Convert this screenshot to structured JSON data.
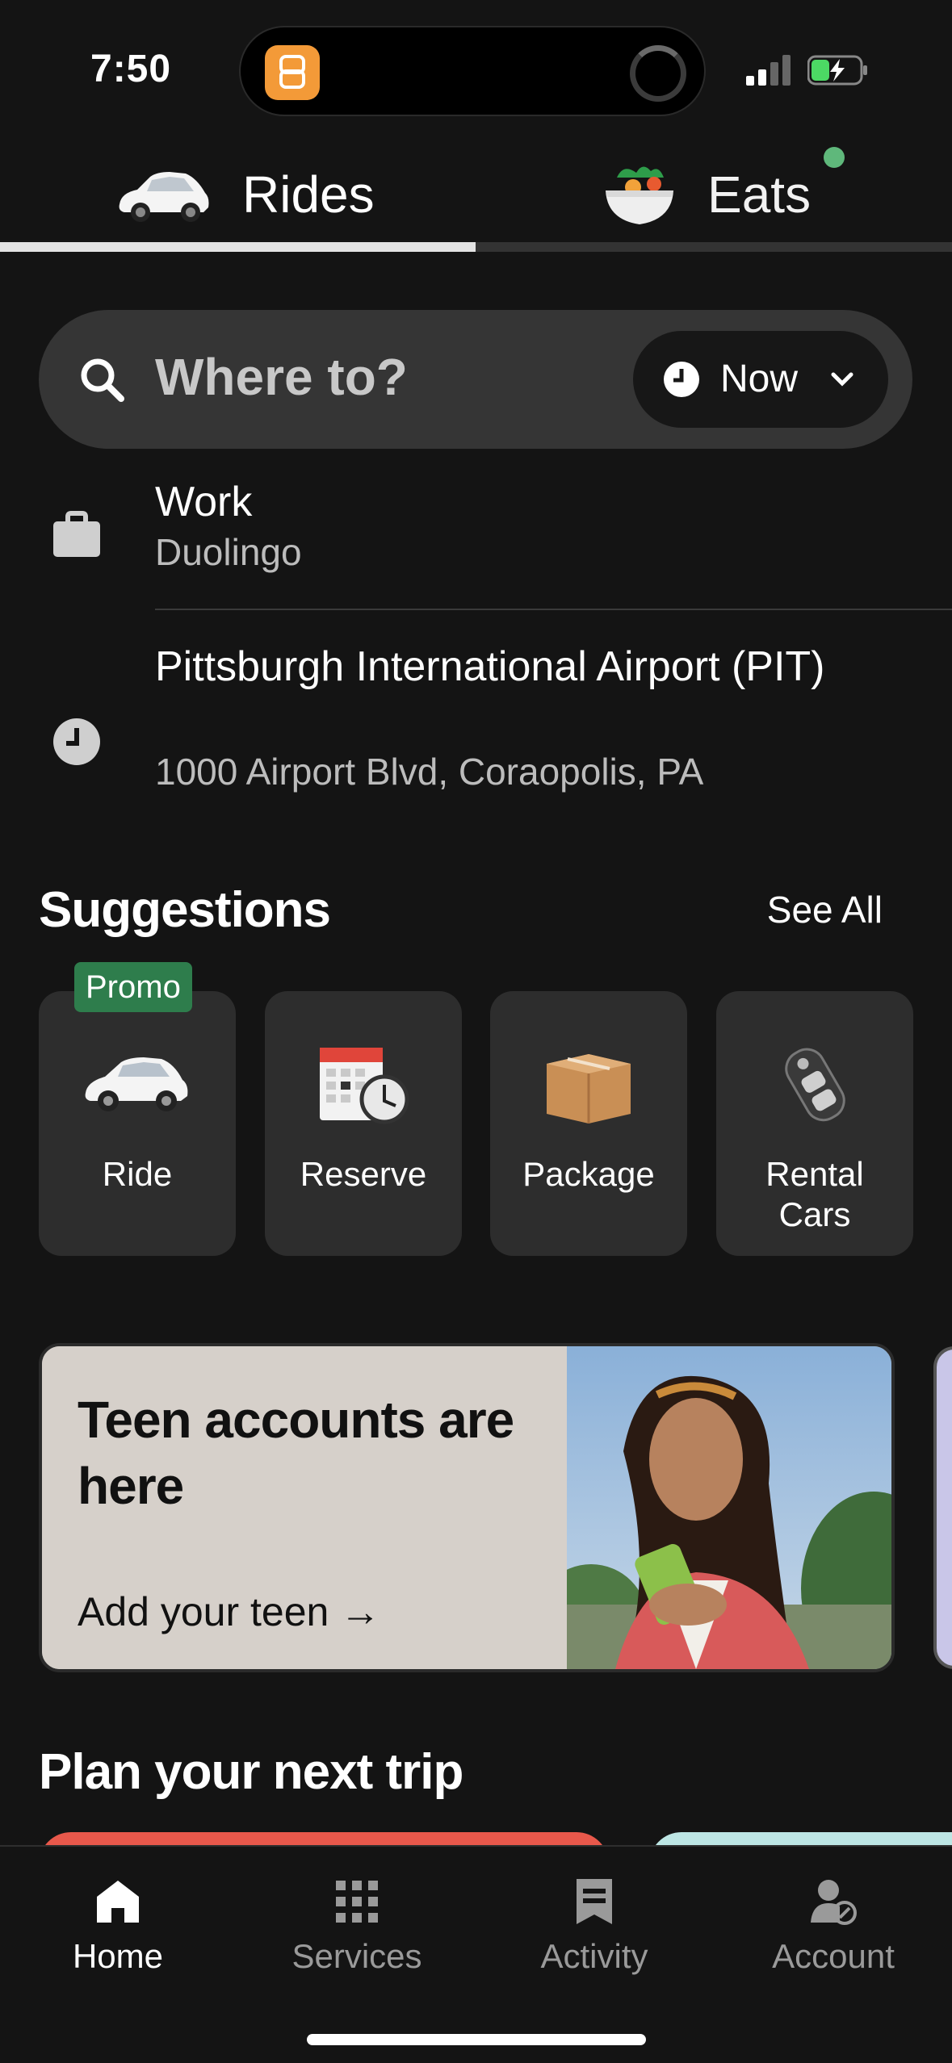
{
  "status_bar": {
    "time": "7:50"
  },
  "top_tabs": [
    {
      "label": "Rides",
      "icon": "car-icon",
      "active": true
    },
    {
      "label": "Eats",
      "icon": "food-bowl-icon",
      "active": false
    }
  ],
  "search": {
    "placeholder": "Where to?",
    "time_option": "Now"
  },
  "recent_places": [
    {
      "title": "Work",
      "subtitle": "Duolingo",
      "icon": "briefcase-icon"
    },
    {
      "title": "Pittsburgh International Airport (PIT)",
      "subtitle": "1000 Airport Blvd, Coraopolis, PA",
      "icon": "clock-icon"
    }
  ],
  "suggestions": {
    "title": "Suggestions",
    "see_all": "See All",
    "promo_badge": "Promo",
    "items": [
      {
        "label": "Ride",
        "icon": "car-icon"
      },
      {
        "label": "Reserve",
        "icon": "calendar-clock-icon"
      },
      {
        "label": "Package",
        "icon": "package-box-icon"
      },
      {
        "label": "Rental Cars",
        "icon": "car-key-icon"
      }
    ]
  },
  "promo_card": {
    "title": "Teen accounts are here",
    "cta": "Add your teen →"
  },
  "plan_section": {
    "title": "Plan your next trip"
  },
  "bottom_nav": [
    {
      "label": "Home",
      "icon": "home-icon",
      "active": true
    },
    {
      "label": "Services",
      "icon": "grid-icon",
      "active": false
    },
    {
      "label": "Activity",
      "icon": "receipt-icon",
      "active": false
    },
    {
      "label": "Account",
      "icon": "person-icon",
      "active": false
    }
  ],
  "colors": {
    "background": "#141414",
    "search_bg": "#353535",
    "promo_green": "#2e7d4c",
    "card_bg": "#2d2d2d"
  }
}
